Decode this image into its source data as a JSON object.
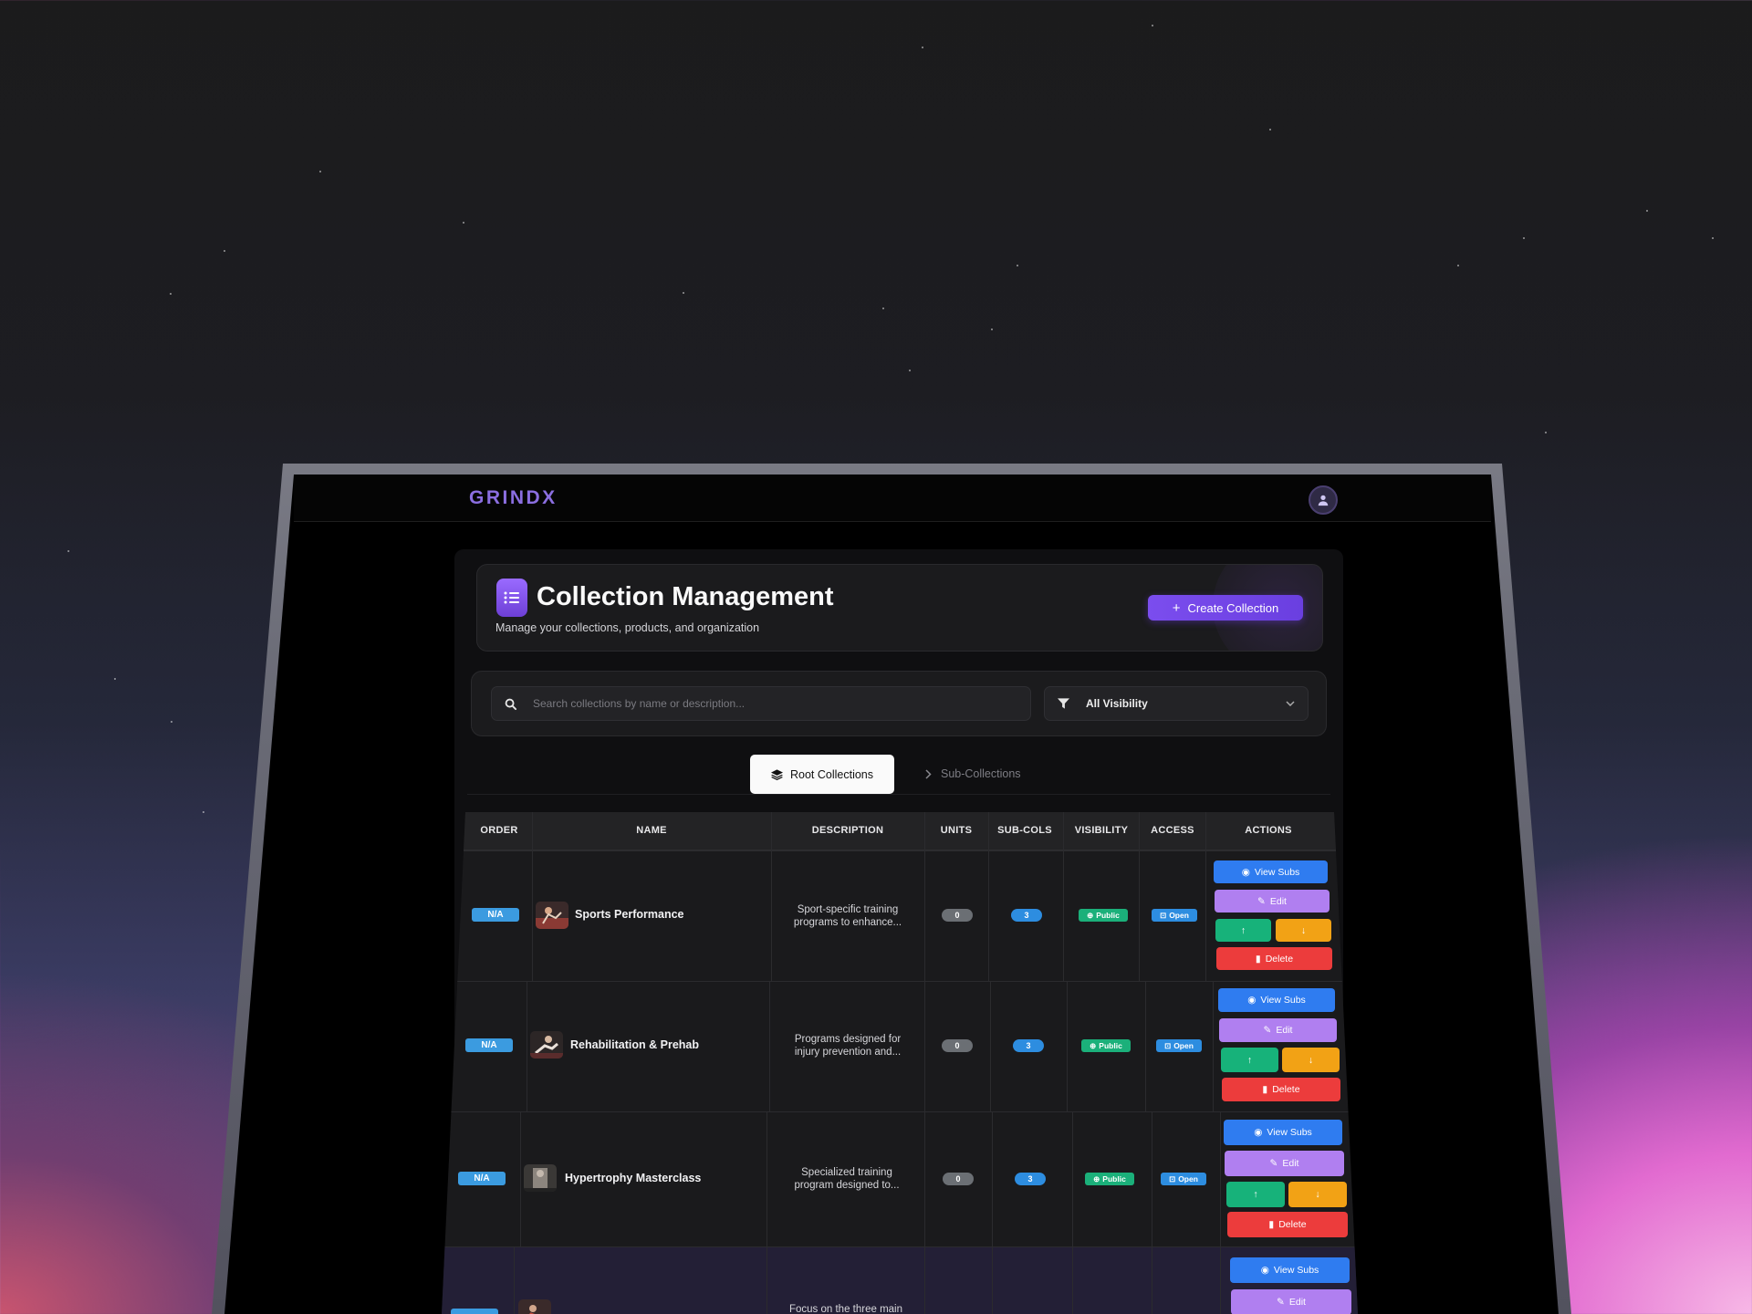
{
  "app": {
    "logo": "GRINDX"
  },
  "header": {
    "title": "Collection Management",
    "subtitle": "Manage your collections, products, and organization",
    "create_label": "Create Collection",
    "create_icon": "plus-icon"
  },
  "filters": {
    "search_placeholder": "Search collections by name or description...",
    "visibility_selected": "All Visibility"
  },
  "tabs": [
    {
      "label": "Root Collections",
      "active": true,
      "icon": "layers-icon"
    },
    {
      "label": "Sub-Collections",
      "active": false,
      "icon": "chevron-right-icon"
    }
  ],
  "table": {
    "columns": [
      "ORDER",
      "NAME",
      "DESCRIPTION",
      "UNITS",
      "SUB-COLS",
      "VISIBILITY",
      "ACCESS",
      "ACTIONS"
    ],
    "rows": [
      {
        "order": "N/A",
        "name": "Sports Performance",
        "description": "Sport-specific training programs to enhance...",
        "units": "0",
        "subcols": "3",
        "visibility": "Public",
        "access": "Open"
      },
      {
        "order": "N/A",
        "name": "Rehabilitation & Prehab",
        "description": "Programs designed for injury prevention and...",
        "units": "0",
        "subcols": "3",
        "visibility": "Public",
        "access": "Open"
      },
      {
        "order": "N/A",
        "name": "Hypertrophy Masterclass",
        "description": "Specialized training program designed to...",
        "units": "0",
        "subcols": "3",
        "visibility": "Public",
        "access": "Open"
      },
      {
        "order": "",
        "name": "",
        "description": "Focus on the three main",
        "units": "",
        "subcols": "",
        "visibility": "",
        "access": ""
      }
    ],
    "actions": {
      "view": "View Subs",
      "edit": "Edit",
      "up": "↑",
      "down": "↓",
      "delete": "Delete"
    }
  },
  "colors": {
    "accent": "#7b4dee",
    "view": "#2f7cf0",
    "edit": "#b07ff0",
    "up": "#17b27a",
    "down": "#f2a215",
    "delete": "#ec3c3c",
    "public": "#1bb07a",
    "open": "#2d8de0"
  }
}
